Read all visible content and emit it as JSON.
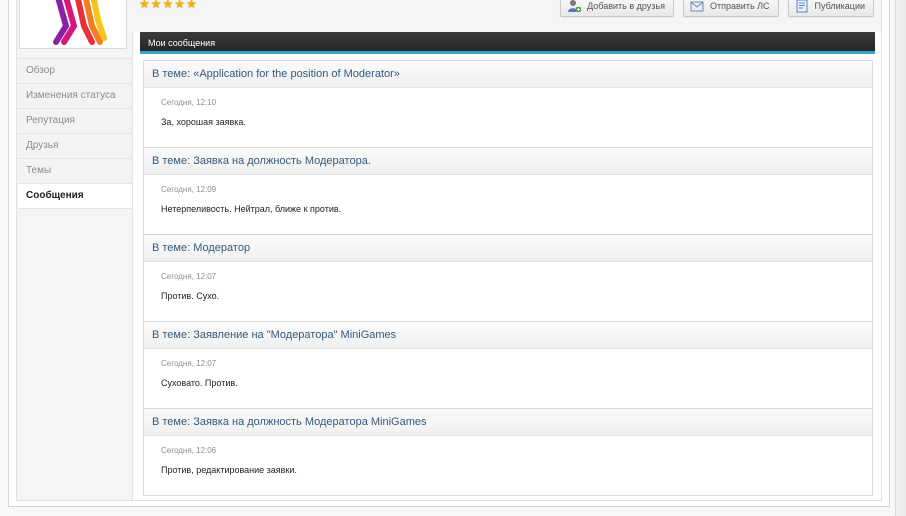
{
  "profile": {
    "rating_stars": 5
  },
  "actions": [
    {
      "label": "Добавить в друзья",
      "icon": "add-friend-icon"
    },
    {
      "label": "Отправить ЛС",
      "icon": "mail-icon"
    },
    {
      "label": "Публикации",
      "icon": "document-icon"
    }
  ],
  "nav": {
    "items": [
      {
        "label": "Обзор"
      },
      {
        "label": "Изменения статуса"
      },
      {
        "label": "Репутация"
      },
      {
        "label": "Друзья"
      },
      {
        "label": "Темы"
      },
      {
        "label": "Сообщения",
        "active": true
      }
    ]
  },
  "section": {
    "title": "Мои сообщения"
  },
  "posts": [
    {
      "topic": "В теме: «Application for the position of Moderator»",
      "date": "Сегодня, 12:10",
      "text": "За, хорошая заявка."
    },
    {
      "topic": "В теме: Заявка на должность Модератора.",
      "date": "Сегодня, 12:09",
      "text": "Нетерпеливость. Нейтрал, ближе к против."
    },
    {
      "topic": "В теме: Модератор",
      "date": "Сегодня, 12:07",
      "text": "Против. Сухо."
    },
    {
      "topic": "В теме: Заявление на \"Модератора\" MiniGames",
      "date": "Сегодня, 12:07",
      "text": "Суховато. Против."
    },
    {
      "topic": "В теме: Заявка на должность Модератора MiniGames",
      "date": "Сегодня, 12:06",
      "text": "Против, редактирование заявки."
    }
  ],
  "colors": {
    "accent": "#31a6c8",
    "link": "#36597a",
    "header_bg": "#2e2e2e"
  }
}
